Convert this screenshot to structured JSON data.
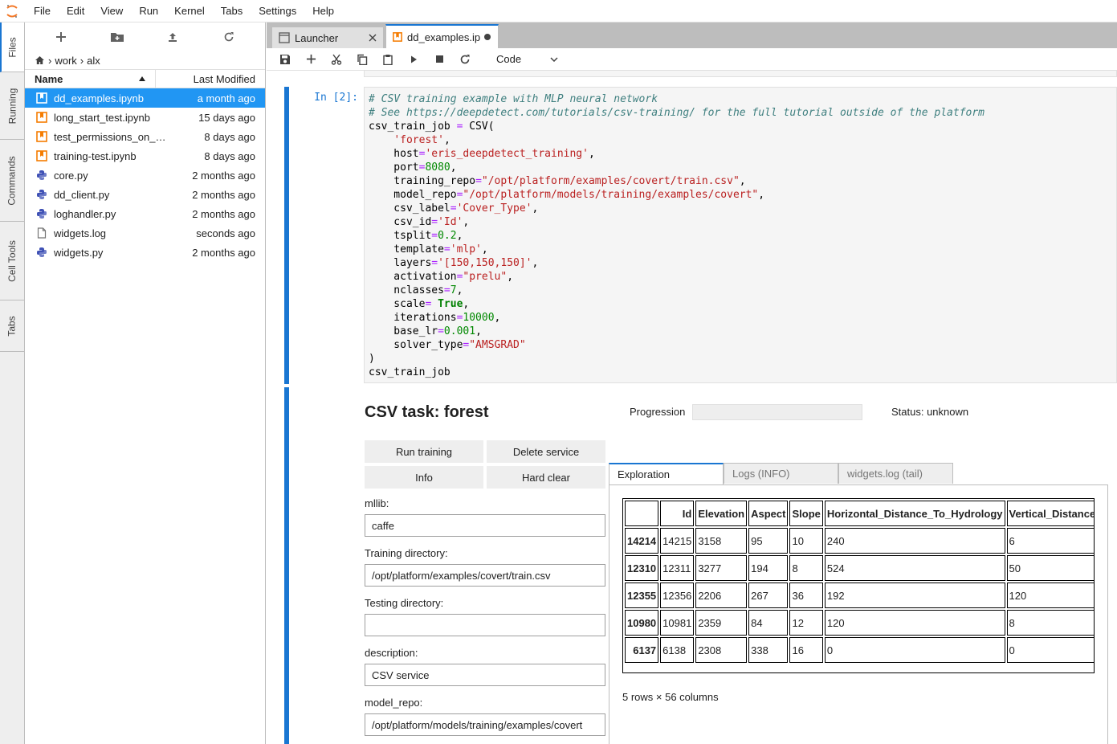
{
  "menubar": {
    "items": [
      "File",
      "Edit",
      "View",
      "Run",
      "Kernel",
      "Tabs",
      "Settings",
      "Help"
    ]
  },
  "left_sidebar": {
    "tabs": [
      "Files",
      "Running",
      "Commands",
      "Cell Tools",
      "Tabs"
    ]
  },
  "file_browser": {
    "breadcrumb": [
      "work",
      "alx"
    ],
    "columns": {
      "name": "Name",
      "modified": "Last Modified"
    },
    "files": [
      {
        "name": "dd_examples.ipynb",
        "modified": "a month ago",
        "icon": "notebook-icon"
      },
      {
        "name": "long_start_test.ipynb",
        "modified": "15 days ago",
        "icon": "notebook-icon"
      },
      {
        "name": "test_permissions_on_…",
        "modified": "8 days ago",
        "icon": "notebook-icon"
      },
      {
        "name": "training-test.ipynb",
        "modified": "8 days ago",
        "icon": "notebook-icon"
      },
      {
        "name": "core.py",
        "modified": "2 months ago",
        "icon": "python-icon"
      },
      {
        "name": "dd_client.py",
        "modified": "2 months ago",
        "icon": "python-icon"
      },
      {
        "name": "loghandler.py",
        "modified": "2 months ago",
        "icon": "python-icon"
      },
      {
        "name": "widgets.log",
        "modified": "seconds ago",
        "icon": "file-icon"
      },
      {
        "name": "widgets.py",
        "modified": "2 months ago",
        "icon": "python-icon"
      }
    ]
  },
  "tabs": {
    "launcher": "Launcher",
    "notebook": "dd_examples.ip"
  },
  "toolbar": {
    "cell_type": "Code"
  },
  "cell": {
    "prompt": "In [2]:"
  },
  "widget": {
    "title": "CSV task: forest",
    "progression_label": "Progression",
    "progression_value": 0,
    "status": "Status: unknown",
    "buttons": {
      "run_training": "Run training",
      "delete_service": "Delete service",
      "info": "Info",
      "hard_clear": "Hard clear"
    },
    "fields": {
      "mllib_label": "mllib:",
      "mllib_value": "caffe",
      "training_dir_label": "Training directory:",
      "training_dir_value": "/opt/platform/examples/covert/train.csv",
      "testing_dir_label": "Testing directory:",
      "testing_dir_value": "",
      "description_label": "description:",
      "description_value": "CSV service",
      "model_repo_label": "model_repo:",
      "model_repo_value": "/opt/platform/models/training/examples/covert"
    },
    "right_tabs": [
      "Exploration",
      "Logs (INFO)",
      "widgets.log (tail)"
    ],
    "dataframe": {
      "columns": [
        "",
        "Id",
        "Elevation",
        "Aspect",
        "Slope",
        "Horizontal_Distance_To_Hydrology",
        "Vertical_Distance_"
      ],
      "rows": [
        [
          "14214",
          "14215",
          "3158",
          "95",
          "10",
          "240",
          "6"
        ],
        [
          "12310",
          "12311",
          "3277",
          "194",
          "8",
          "524",
          "50"
        ],
        [
          "12355",
          "12356",
          "2206",
          "267",
          "36",
          "192",
          "120"
        ],
        [
          "10980",
          "10981",
          "2359",
          "84",
          "12",
          "120",
          "8"
        ],
        [
          "6137",
          "6138",
          "2308",
          "338",
          "16",
          "0",
          "0"
        ]
      ],
      "shape": "5 rows × 56 columns"
    }
  }
}
